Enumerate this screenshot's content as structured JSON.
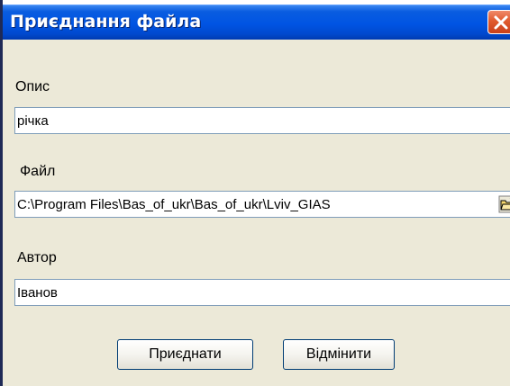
{
  "window": {
    "title": "Приєднання файла"
  },
  "form": {
    "description": {
      "label": "Опис",
      "value": "річка"
    },
    "file": {
      "label": "Файл",
      "value": "C:\\Program Files\\Bas_of_ukr\\Bas_of_ukr\\Lviv_GIAS"
    },
    "author": {
      "label": "Автор",
      "value": "Іванов"
    }
  },
  "buttons": {
    "attach": "Приєднати",
    "cancel": "Відмінити"
  },
  "icons": {
    "close": "close-icon",
    "browse": "open-folder-icon"
  }
}
